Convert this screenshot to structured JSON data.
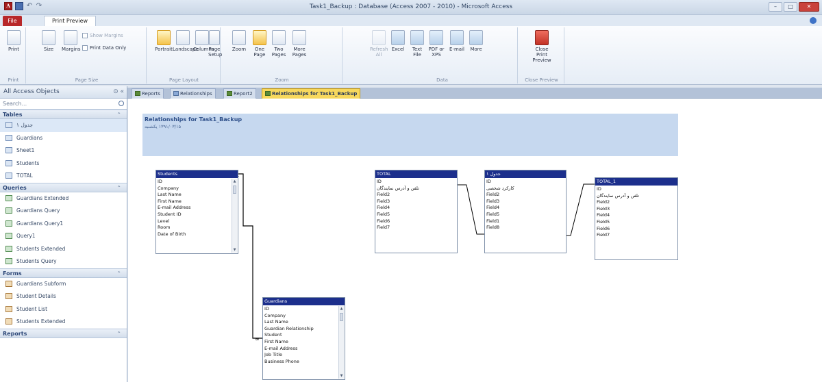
{
  "window": {
    "title": "Task1_Backup : Database (Access 2007 - 2010) - Microsoft Access",
    "app_icon": "A",
    "controls": [
      "–",
      "□",
      "✕"
    ]
  },
  "ribbon_tabs": {
    "file": "File",
    "print_preview": "Print Preview"
  },
  "ribbon": {
    "print_group": {
      "print": "Print",
      "label": "Print"
    },
    "page_size_group": {
      "size": "Size",
      "margins": "Margins",
      "show_margins": "Show Margins",
      "print_data_only": "Print Data Only",
      "label": "Page Size"
    },
    "page_layout_group": {
      "portrait": "Portrait",
      "landscape": "Landscape",
      "columns": "Columns",
      "page_setup": "Page Setup",
      "label": "Page Layout"
    },
    "zoom_group": {
      "zoom": "Zoom",
      "one_page": "One Page",
      "two_pages": "Two Pages",
      "more_pages": "More Pages",
      "label": "Zoom"
    },
    "data_group": {
      "refresh_all": "Refresh All",
      "excel": "Excel",
      "text_file": "Text File",
      "pdf_xps": "PDF or XPS",
      "email": "E-mail",
      "more": "More",
      "label": "Data"
    },
    "close_group": {
      "close_preview": "Close Print Preview",
      "label": "Close Preview"
    }
  },
  "doc_tabs": [
    "Reports",
    "Relationships",
    "Report2",
    "Relationships for Task1_Backup"
  ],
  "nav": {
    "header": "All Access Objects",
    "search_placeholder": "Search...",
    "sections": [
      {
        "title": "Tables",
        "items": [
          "جدول ۱",
          "Guardians",
          "Sheet1",
          "Students",
          "TOTAL"
        ]
      },
      {
        "title": "Queries",
        "items": [
          "Guardians Extended",
          "Guardians Query",
          "Guardians Query1",
          "Query1",
          "Students Extended",
          "Students Query"
        ]
      },
      {
        "title": "Forms",
        "items": [
          "Guardians Subform",
          "Student Details",
          "Student List",
          "Students Extended"
        ]
      },
      {
        "title": "Reports",
        "items": []
      }
    ]
  },
  "report": {
    "title": "Relationships for Task1_Backup",
    "date": "۱۳۹۱/۰۳/۱۵ یکشنبه"
  },
  "tables": {
    "students": {
      "name": "Students",
      "fields": [
        "ID",
        "Company",
        "Last Name",
        "First Name",
        "E-mail Address",
        "Student ID",
        "Level",
        "Room",
        "Date of Birth"
      ]
    },
    "guardians": {
      "name": "Guardians",
      "fields": [
        "ID",
        "Company",
        "Last Name",
        "Guardian Relationship",
        "Student",
        "First Name",
        "E-mail Address",
        "Job Title",
        "Business Phone"
      ]
    },
    "total": {
      "name": "TOTAL",
      "fields": [
        "ID",
        "تلفن و آدرس نمایندگان",
        "Field2",
        "Field3",
        "Field4",
        "Field5",
        "Field6",
        "Field7"
      ]
    },
    "jadval1": {
      "name": "جدول ۱",
      "fields": [
        "ID",
        "کارکرد شخصی",
        "Field2",
        "Field3",
        "Field4",
        "Field5",
        "Field1",
        "Field8"
      ]
    },
    "total1": {
      "name": "TOTAL_1",
      "fields": [
        "ID",
        "تلفن و آدرس نمایندگان",
        "Field2",
        "Field3",
        "Field4",
        "Field5",
        "Field6",
        "Field7"
      ]
    }
  },
  "colors": {
    "table_header": "#1c2f8c",
    "report_header": "#c6d8ef",
    "active_tab": "#f7d85d",
    "file_tab": "#b8282a"
  }
}
